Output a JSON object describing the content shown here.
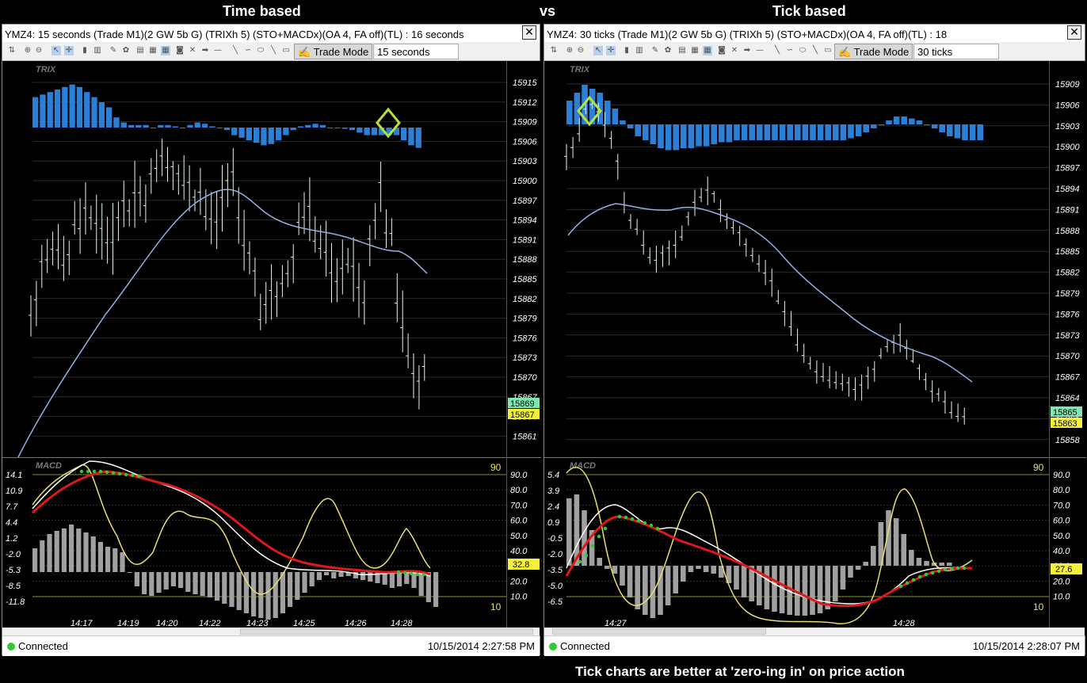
{
  "headers": {
    "left": "Time based",
    "vs": "vs",
    "right": "Tick based"
  },
  "caption": "Tick charts are better at 'zero-ing in' on price action",
  "windows": [
    {
      "title": "YMZ4: 15 seconds (Trade M1)(2 GW 5b G) (TRIXh 5) (STO+MACDx)(OA 4, FA off)(TL) : 16 seconds",
      "close_glyph": "✕",
      "trade_mode_label": "Trade Mode",
      "period_value": "15 seconds",
      "status": {
        "connection": "Connected",
        "timestamp": "10/15/2014 2:27:58 PM"
      },
      "price_panel": {
        "indicator_label": "TRIX",
        "price_axis": [
          "15915",
          "15912",
          "15909",
          "15906",
          "15903",
          "15900",
          "15897",
          "15894",
          "15891",
          "15888",
          "15885",
          "15882",
          "15879",
          "15876",
          "15873",
          "15870",
          "15867",
          "15864",
          "15861"
        ],
        "bid_tag": "15869",
        "ask_tag": "15867"
      },
      "osc_panel": {
        "indicator_label": "MACD",
        "left_axis": [
          "14.1",
          "10.9",
          "7.7",
          "4.4",
          "1.2",
          "-2.0",
          "-5.3",
          "-8.5",
          "-11.8"
        ],
        "right_axis": [
          "90.0",
          "80.0",
          "70.0",
          "60.0",
          "50.0",
          "40.0",
          "30.0",
          "20.0",
          "10.0"
        ],
        "level_high": "90",
        "level_low": "10",
        "value_tag": "32.8"
      },
      "time_axis": [
        "14:17",
        "14:19",
        "14:20",
        "14:22",
        "14:23",
        "14:25",
        "14:26",
        "14:28"
      ]
    },
    {
      "title": "YMZ4: 30 ticks (Trade M1)(2 GW 5b G) (TRIXh 5) (STO+MACDx)(OA 4, FA off)(TL) : 18",
      "close_glyph": "✕",
      "trade_mode_label": "Trade Mode",
      "period_value": "30 ticks",
      "status": {
        "connection": "Connected",
        "timestamp": "10/15/2014 2:28:07 PM"
      },
      "price_panel": {
        "indicator_label": "TRIX",
        "price_axis": [
          "15909",
          "15906",
          "15903",
          "15900",
          "15897",
          "15894",
          "15891",
          "15888",
          "15885",
          "15882",
          "15879",
          "15876",
          "15873",
          "15870",
          "15867",
          "15864",
          "15861",
          "15858"
        ],
        "bid_tag": "15865",
        "ask_tag": "15863"
      },
      "osc_panel": {
        "indicator_label": "MACD",
        "left_axis": [
          "5.4",
          "3.9",
          "2.4",
          "0.9",
          "-0.5",
          "-2.0",
          "-3.5",
          "-5.0",
          "-6.5"
        ],
        "right_axis": [
          "90.0",
          "80.0",
          "70.0",
          "60.0",
          "50.0",
          "40.0",
          "30.0",
          "20.0",
          "10.0"
        ],
        "level_high": "90",
        "level_low": "10",
        "value_tag": "27.6"
      },
      "time_axis": [
        "14:27",
        "14:28"
      ]
    }
  ],
  "colors": {
    "trix_bars": "#2b7fd6",
    "price_bars": "#e8f5e8",
    "moving_average": "#8fb3e6",
    "macd_histogram": "#a0a0a0",
    "macd_line": "#ffffff",
    "signal_line": "#e01818",
    "signal_dots": "#2ecc2e",
    "stochastic": "#e8e070",
    "level_lines": "#8a8a2a",
    "bid_tag": "#7ce8b0",
    "ask_tag": "#f5f03a",
    "marker": "#b8e03a"
  }
}
